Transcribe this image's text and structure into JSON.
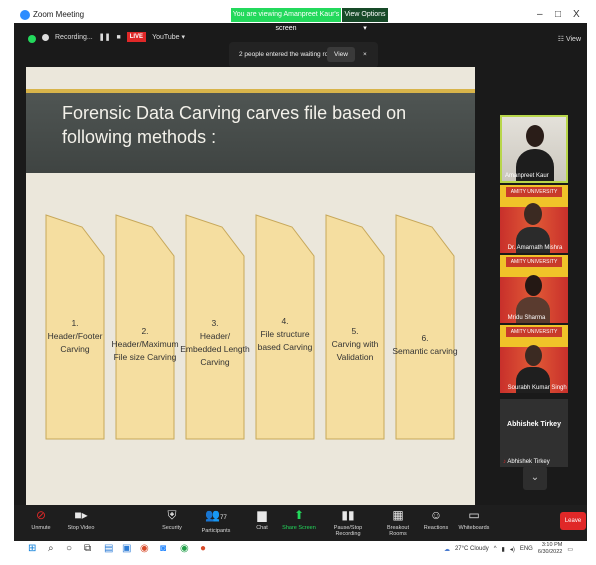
{
  "window": {
    "title": "Zoom Meeting",
    "viewing_banner": "You are viewing Amanpreet Kaur's screen",
    "view_options": "View Options ▾",
    "controls": [
      "–",
      "□",
      "X"
    ]
  },
  "recording": {
    "label": "Recording...",
    "live_badge": "LIVE",
    "stream": "YouTube ▾",
    "view_label": "View"
  },
  "notification": {
    "message": "2 people entered the waiting room",
    "view_button": "View",
    "close": "×"
  },
  "slide": {
    "title": "Forensic Data Carving carves file based on following methods :",
    "methods": [
      {
        "num": "1.",
        "text": "Header/Footer Carving"
      },
      {
        "num": "2.",
        "text": "Header/Maximum File size Carving"
      },
      {
        "num": "3.",
        "text": "Header/ Embedded Length Carving"
      },
      {
        "num": "4.",
        "text": "File structure based Carving"
      },
      {
        "num": "5.",
        "text": "Carving with Validation"
      },
      {
        "num": "6.",
        "text": "Semantic carving"
      }
    ],
    "colors": {
      "arrow_fill": "#f5dea0",
      "arrow_stroke": "#c7a85a",
      "chalkboard": "#4a4f4d",
      "accent": "#d8b44a"
    }
  },
  "participants": [
    {
      "name": "Amanpreet Kaur"
    },
    {
      "name": "Dr. Amarnath Mishra",
      "banner": "AMITY UNIVERSITY"
    },
    {
      "name": "Mridu Sharma",
      "banner": "AMITY UNIVERSITY"
    },
    {
      "name": "Sourabh Kumar Singh",
      "banner": "AMITY UNIVERSITY"
    },
    {
      "name": "Abhishek Tirkey",
      "big_name": "Abhishek Tirkey"
    }
  ],
  "toolbar": {
    "items": [
      {
        "label": "Unmute",
        "icon": "mic-muted-icon"
      },
      {
        "label": "Stop Video",
        "icon": "video-icon"
      },
      {
        "label": "Security",
        "icon": "shield-icon"
      },
      {
        "label": "Participants",
        "icon": "participants-icon",
        "count": "77"
      },
      {
        "label": "Chat",
        "icon": "chat-icon"
      },
      {
        "label": "Share Screen",
        "icon": "share-screen-icon"
      },
      {
        "label": "Pause/Stop Recording",
        "icon": "recording-icon"
      },
      {
        "label": "Breakout Rooms",
        "icon": "breakout-icon"
      },
      {
        "label": "Reactions",
        "icon": "reactions-icon"
      },
      {
        "label": "Whiteboards",
        "icon": "whiteboard-icon"
      }
    ],
    "leave": "Leave"
  },
  "taskbar": {
    "weather": "27°C  Cloudy",
    "language": "ENG",
    "time": "3:10 PM",
    "date": "6/30/2022"
  }
}
